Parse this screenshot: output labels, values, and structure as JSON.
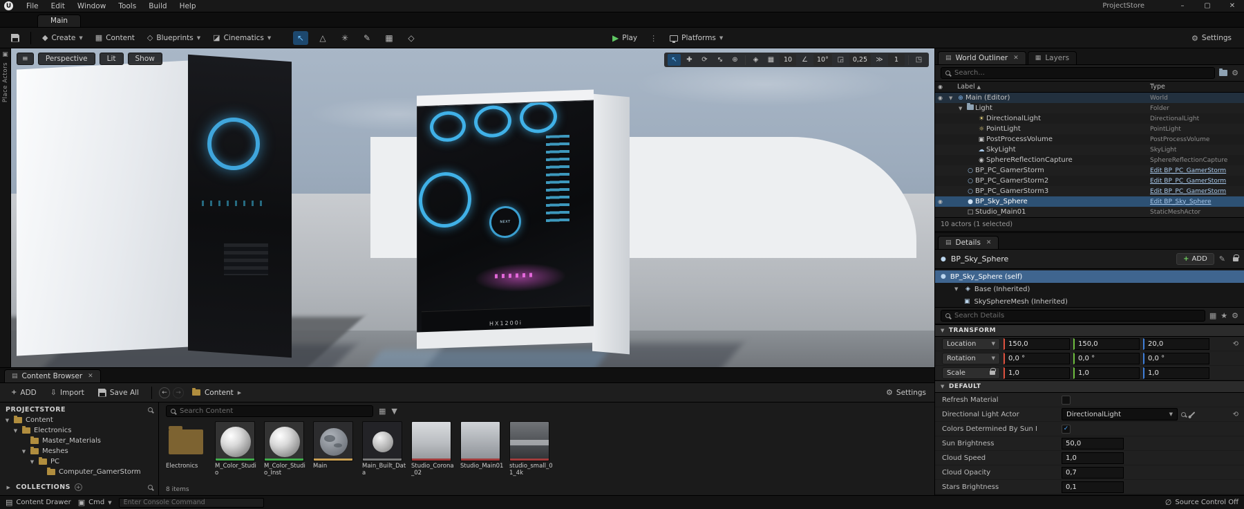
{
  "menubar": {
    "menus": [
      "File",
      "Edit",
      "Window",
      "Tools",
      "Build",
      "Help"
    ],
    "project_name": "ProjectStore"
  },
  "level_tab": "Main",
  "toolbar": {
    "create": "Create",
    "content": "Content",
    "blueprints": "Blueprints",
    "cinematics": "Cinematics",
    "play": "Play",
    "platforms": "Platforms",
    "settings": "Settings"
  },
  "viewport": {
    "place_actors": "Place Actors",
    "perspective": "Perspective",
    "lit": "Lit",
    "show": "Show",
    "grid_snap": "10",
    "rotation_snap": "10°",
    "scale_snap": "0,25",
    "camera_speed": "1",
    "psu_label": "HX1200i"
  },
  "outliner": {
    "tab_outliner": "World Outliner",
    "tab_layers": "Layers",
    "search_placeholder": "Search...",
    "col_label": "Label",
    "col_type": "Type",
    "rows": [
      {
        "label": "Main (Editor)",
        "type": "World",
        "selected": false
      },
      {
        "label": "Light",
        "type": "Folder",
        "selected": false
      },
      {
        "label": "DirectionalLight",
        "type": "DirectionalLight",
        "selected": false
      },
      {
        "label": "PointLight",
        "type": "PointLight",
        "selected": false
      },
      {
        "label": "PostProcessVolume",
        "type": "PostProcessVolume",
        "selected": false
      },
      {
        "label": "SkyLight",
        "type": "SkyLight",
        "selected": false
      },
      {
        "label": "SphereReflectionCapture",
        "type": "SphereReflectionCapture",
        "selected": false
      },
      {
        "label": "BP_PC_GamerStorm",
        "type": "Edit BP_PC_GamerStorm",
        "selected": false
      },
      {
        "label": "BP_PC_GamerStorm2",
        "type": "Edit BP_PC_GamerStorm",
        "selected": false
      },
      {
        "label": "BP_PC_GamerStorm3",
        "type": "Edit BP_PC_GamerStorm",
        "selected": false
      },
      {
        "label": "BP_Sky_Sphere",
        "type": "Edit BP_Sky_Sphere",
        "selected": true
      },
      {
        "label": "Studio_Main01",
        "type": "StaticMeshActor",
        "selected": false
      }
    ],
    "footer": "10 actors (1 selected)"
  },
  "details": {
    "tab": "Details",
    "actor_name": "BP_Sky_Sphere",
    "add_label": "ADD",
    "components": [
      {
        "name": "BP_Sky_Sphere (self)",
        "selected": true
      },
      {
        "name": "Base (Inherited)",
        "selected": false
      },
      {
        "name": "SkySphereMesh (Inherited)",
        "selected": false
      }
    ],
    "search_placeholder": "Search Details",
    "transform": {
      "section": "TRANSFORM",
      "location_label": "Location",
      "location": [
        "150,0",
        "150,0",
        "20,0"
      ],
      "rotation_label": "Rotation",
      "rotation": [
        "0,0 °",
        "0,0 °",
        "0,0 °"
      ],
      "scale_label": "Scale",
      "scale": [
        "1,0",
        "1,0",
        "1,0"
      ]
    },
    "default": {
      "section": "DEFAULT",
      "rows": [
        {
          "label": "Refresh Material",
          "control": "checkbox",
          "checked": false
        },
        {
          "label": "Directional Light Actor",
          "control": "dropdown",
          "value": "DirectionalLight"
        },
        {
          "label": "Colors Determined By Sun I",
          "control": "checkbox",
          "checked": true
        },
        {
          "label": "Sun Brightness",
          "control": "number",
          "value": "50,0"
        },
        {
          "label": "Cloud Speed",
          "control": "number",
          "value": "1,0"
        },
        {
          "label": "Cloud Opacity",
          "control": "number",
          "value": "0,7"
        },
        {
          "label": "Stars Brightness",
          "control": "number",
          "value": "0,1"
        }
      ]
    }
  },
  "content_browser": {
    "tab": "Content Browser",
    "add_label": "ADD",
    "import_label": "Import",
    "save_all_label": "Save All",
    "breadcrumb_root": "Content",
    "settings_label": "Settings",
    "search_placeholder": "Search Content",
    "sources_title": "PROJECTSTORE",
    "tree": [
      {
        "label": "Content"
      },
      {
        "label": "Electronics"
      },
      {
        "label": "Master_Materials"
      },
      {
        "label": "Meshes"
      },
      {
        "label": "PC"
      },
      {
        "label": "Computer_GamerStorm"
      }
    ],
    "collections_label": "COLLECTIONS",
    "assets": [
      {
        "name": "Electronics",
        "kind": "folder"
      },
      {
        "name": "M_Color_Studio",
        "kind": "material"
      },
      {
        "name": "M_Color_Studio_Inst",
        "kind": "material-instance"
      },
      {
        "name": "Main",
        "kind": "level"
      },
      {
        "name": "Main_Built_Data",
        "kind": "build-data"
      },
      {
        "name": "Studio_Corona_02",
        "kind": "texture"
      },
      {
        "name": "Studio_Main01",
        "kind": "texture"
      },
      {
        "name": "studio_small_01_4k",
        "kind": "texture"
      }
    ],
    "items_count": "8 items"
  },
  "statusbar": {
    "content_drawer": "Content Drawer",
    "cmd": "Cmd",
    "console_placeholder": "Enter Console Command",
    "source_control": "Source Control Off"
  }
}
